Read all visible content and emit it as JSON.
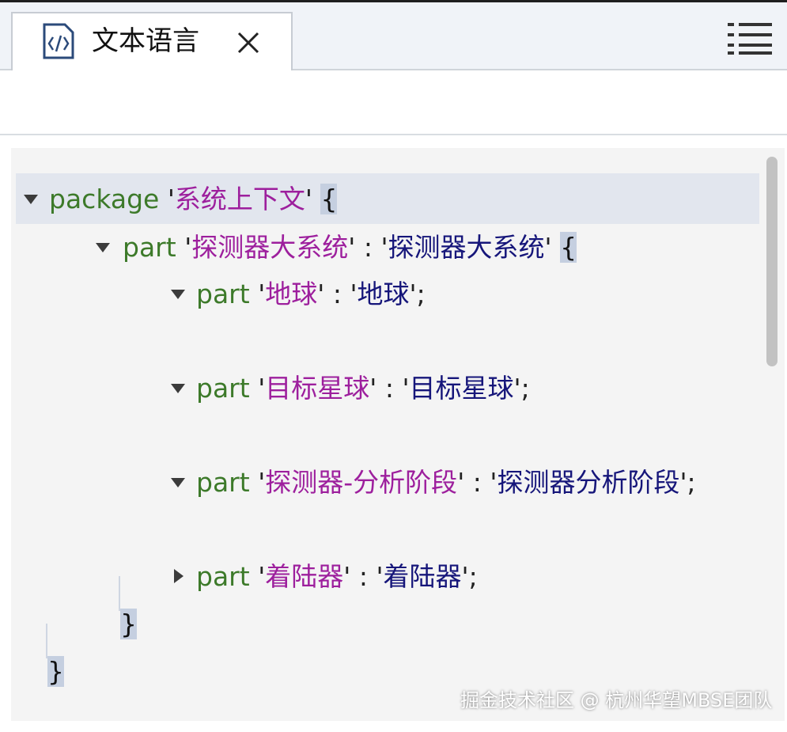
{
  "tab": {
    "label": "文本语言",
    "icon": "code-file-icon",
    "close_icon": "close-icon"
  },
  "menu": {
    "icon": "hamburger-menu-icon"
  },
  "code": {
    "line1": {
      "keyword": "package",
      "q1": "'",
      "name": "系统上下文",
      "q2": "'",
      "sp": " ",
      "brace": "{"
    },
    "line2": {
      "keyword": "part",
      "q1": "'",
      "name": "探测器大系统",
      "q2": "'",
      "colon": " : ",
      "q3": "'",
      "type": "探测器大系统",
      "q4": "'",
      "sp": " ",
      "brace": "{"
    },
    "line3": {
      "keyword": "part",
      "q1": "'",
      "name": "地球",
      "q2": "'",
      "colon": " : ",
      "q3": "'",
      "type": "地球",
      "q4": "'",
      "semi": ";"
    },
    "line4": {
      "keyword": "part",
      "q1": "'",
      "name": "目标星球",
      "q2": "'",
      "colon": " : ",
      "q3": "'",
      "type": "目标星球",
      "q4": "'",
      "semi": ";"
    },
    "line5": {
      "keyword": "part",
      "q1": "'",
      "name": "探测器-分析阶段",
      "q2": "'",
      "colon": " : ",
      "q3": "'",
      "type": "探测器分析阶段",
      "q4": "'",
      "semi": ";"
    },
    "line6": {
      "keyword": "part",
      "q1": "'",
      "name": "着陆器",
      "q2": "'",
      "colon": " : ",
      "q3": "'",
      "type": "着陆器",
      "q4": "'",
      "semi": ";"
    },
    "close_inner": "}",
    "close_outer": "}"
  },
  "watermark": "掘金技术社区 @ 杭州华望MBSE团队",
  "colors": {
    "keyword": "#3d7a2a",
    "name": "#9d1f9d",
    "type": "#16167a",
    "highlight": "#e2e6ee"
  }
}
